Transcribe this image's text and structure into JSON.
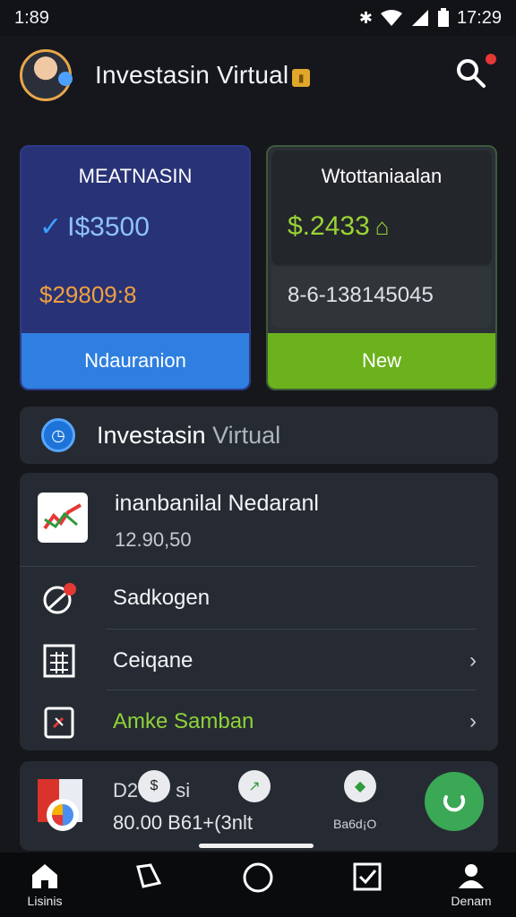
{
  "status": {
    "time_left": "1:89",
    "time_right": "17:29"
  },
  "header": {
    "title": "Investasin Virtual"
  },
  "cards": [
    {
      "label": "MEATNASIN",
      "value": "I$3500",
      "sub": "$29809:8",
      "button": "Ndauranion"
    },
    {
      "label": "Wtottaniaalan",
      "value": "$.2433",
      "sub": "8-6-138145045",
      "button": "New"
    }
  ],
  "banner": {
    "title_main": "Investasin",
    "title_muted": "Virtual"
  },
  "list": {
    "first": {
      "title": "inanbanilal Nedaranl",
      "subtitle": "12.90,50"
    },
    "items": [
      {
        "label": "Sadkogen"
      },
      {
        "label": "Ceiqane"
      },
      {
        "label": "Amke Samban"
      }
    ]
  },
  "bottom_card": {
    "title": "D2",
    "title_suffix": "si",
    "sub": "80.00 B61+(3nlt",
    "caption": "Ba6d¡O"
  },
  "nav": [
    {
      "label": "Lisinis",
      "icon": "home-icon"
    },
    {
      "label": "",
      "icon": "tag-icon"
    },
    {
      "label": "",
      "icon": "circle-icon"
    },
    {
      "label": "",
      "icon": "checkbox-icon"
    },
    {
      "label": "Denam",
      "icon": "user-icon"
    }
  ],
  "colors": {
    "accent_blue": "#2f7fe0",
    "accent_green": "#6bb21d",
    "fab_green": "#3aa855",
    "warn_orange": "#f0a040"
  }
}
